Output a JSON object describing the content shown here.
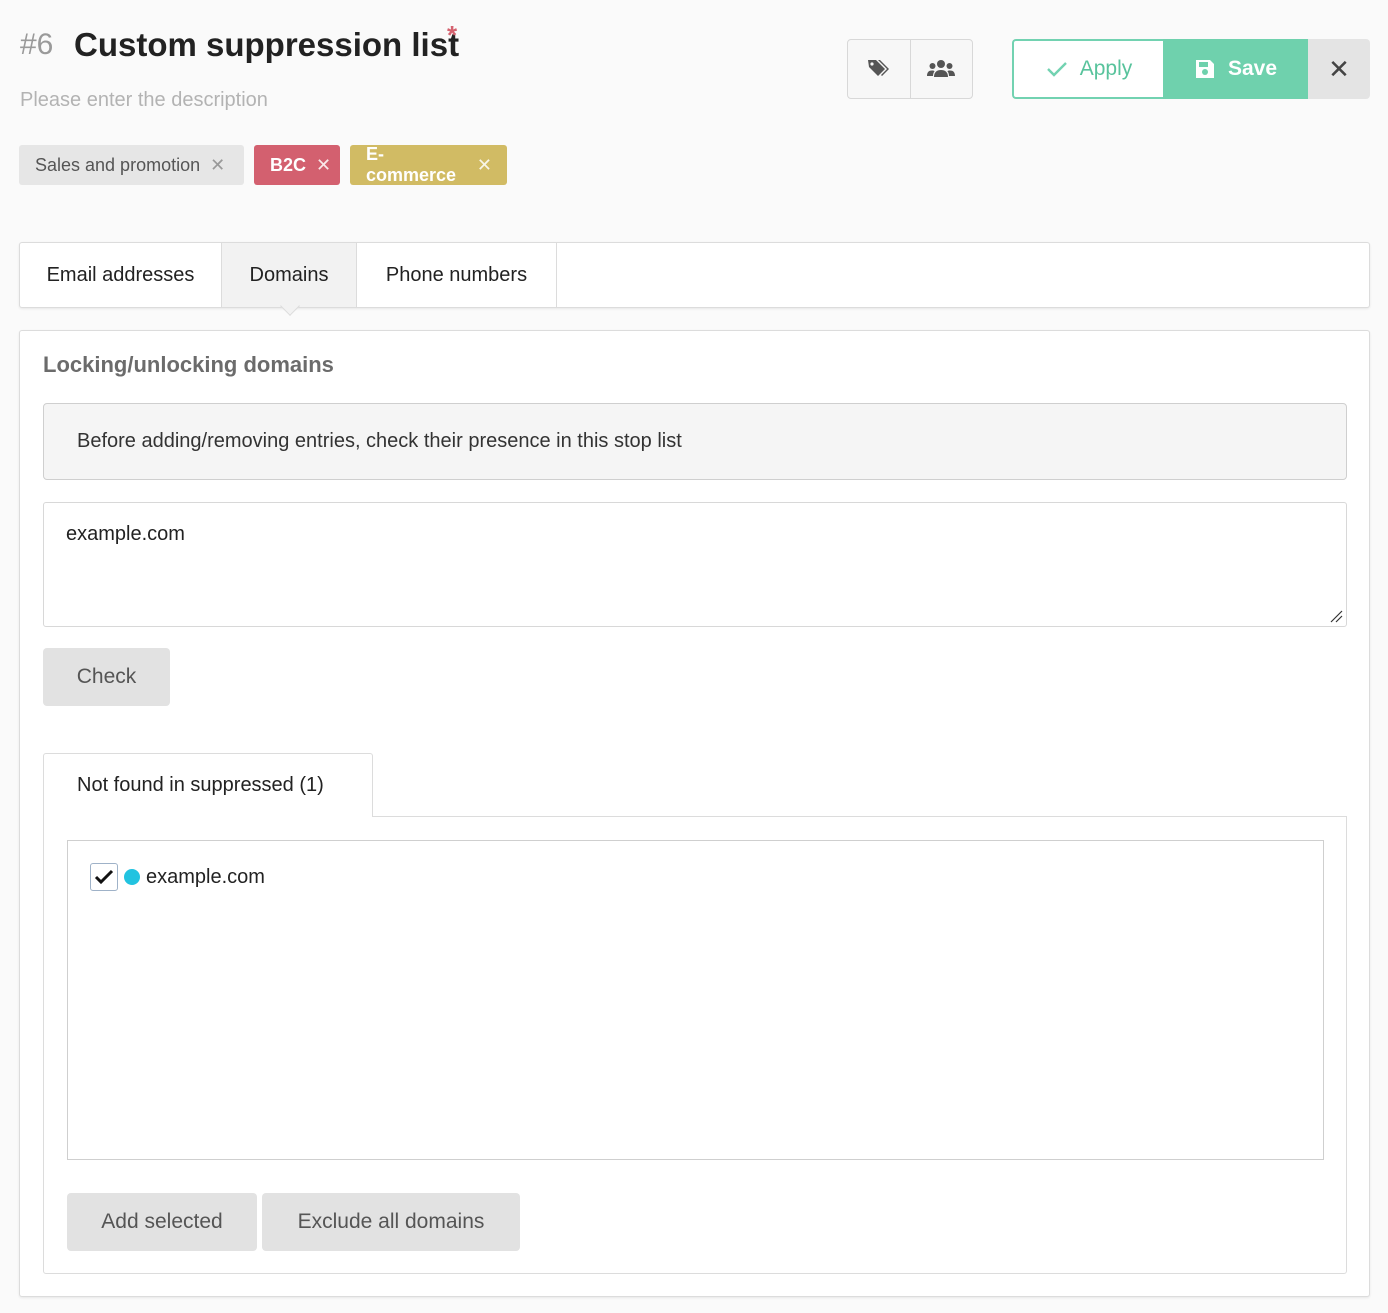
{
  "header": {
    "number": "#6",
    "title": "Custom suppression list",
    "required_mark": "*",
    "description_placeholder": "Please enter the description"
  },
  "toolbar": {
    "icons": [
      "tags-icon",
      "users-icon"
    ],
    "apply_label": "Apply",
    "save_label": "Save",
    "close_label": "✕"
  },
  "tags": [
    {
      "label": "Sales and promotion",
      "color": "#e6e6e6"
    },
    {
      "label": "B2C",
      "color": "#d3606f"
    },
    {
      "label": "E-commerce",
      "color": "#d1bb64"
    }
  ],
  "tags_remove_glyph": "✕",
  "tabs": [
    {
      "label": "Email addresses",
      "active": false
    },
    {
      "label": "Domains",
      "active": true
    },
    {
      "label": "Phone numbers",
      "active": false
    }
  ],
  "domains": {
    "section_title": "Locking/unlocking domains",
    "info_text": "Before adding/removing entries, check their presence in this stop list",
    "input_value": "example.com",
    "check_label": "Check",
    "result_tab_label": "Not found in suppressed (1)",
    "results": [
      {
        "value": "example.com",
        "checked": true,
        "dot_color": "#22c3e0"
      }
    ],
    "add_selected_label": "Add selected",
    "exclude_all_label": "Exclude all domains"
  },
  "colors": {
    "accent_green": "#6fd1ad",
    "b2c": "#d3606f",
    "ecommerce": "#d1bb64"
  }
}
